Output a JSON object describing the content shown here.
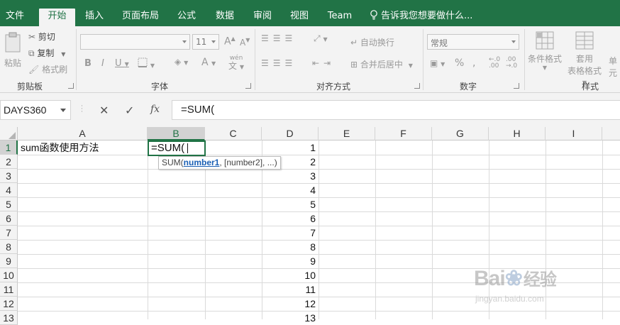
{
  "tabs": [
    {
      "label": "文件",
      "active": false
    },
    {
      "label": "开始",
      "active": true
    },
    {
      "label": "插入",
      "active": false
    },
    {
      "label": "页面布局",
      "active": false
    },
    {
      "label": "公式",
      "active": false
    },
    {
      "label": "数据",
      "active": false
    },
    {
      "label": "审阅",
      "active": false
    },
    {
      "label": "视图",
      "active": false
    },
    {
      "label": "Team",
      "active": false
    }
  ],
  "tell_me": "告诉我您想要做什么...",
  "ribbon": {
    "clipboard": {
      "paste": "粘贴",
      "cut": "剪切",
      "copy": "复制",
      "format_painter": "格式刷",
      "label": "剪贴板"
    },
    "font": {
      "size": "11",
      "label": "字体",
      "phonetic": "wén"
    },
    "alignment": {
      "wrap": "自动换行",
      "merge": "合并后居中",
      "label": "对齐方式"
    },
    "number": {
      "format": "常规",
      "label": "数字"
    },
    "styles": {
      "conditional": "条件格式",
      "table_format_1": "套用",
      "table_format_2": "表格格式",
      "cell_styles": "单元",
      "label": "样式"
    }
  },
  "formula_bar": {
    "name_box": "DAYS360",
    "formula": "=SUM("
  },
  "columns": [
    "A",
    "B",
    "C",
    "D",
    "E",
    "F",
    "G",
    "H",
    "I"
  ],
  "selected_column": "B",
  "rows": [
    "1",
    "2",
    "3",
    "4",
    "5",
    "6",
    "7",
    "8",
    "9",
    "10",
    "11",
    "12",
    "13"
  ],
  "cells": {
    "A1": "sum函数使用方法",
    "B1": "=SUM(",
    "D": [
      "1",
      "2",
      "3",
      "4",
      "5",
      "6",
      "7",
      "8",
      "9",
      "10",
      "11",
      "12",
      "13"
    ]
  },
  "tooltip": {
    "fn": "SUM(",
    "arg1": "number1",
    "rest": ", [number2], ...)"
  },
  "watermark": {
    "brand": "Bai",
    "brand2": "经验",
    "url": "jingyan.baidu.com"
  },
  "colors": {
    "accent": "#217346",
    "ribbon_bg": "#f3f3f3",
    "link": "#1a5fb4"
  }
}
